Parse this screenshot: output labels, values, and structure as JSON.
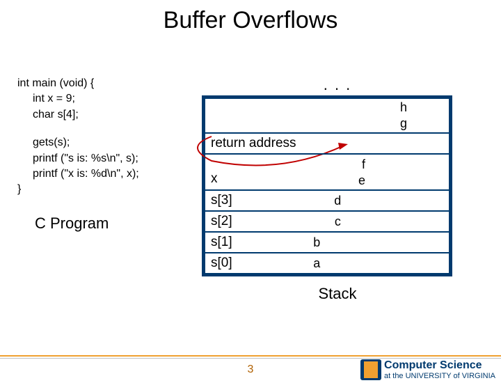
{
  "title": "Buffer Overflows",
  "code": {
    "line1": "int main (void) {",
    "line2": "int x = 9;",
    "line3": "char s[4];",
    "line4": "gets(s);",
    "line5": "printf (\"s is: %s\\n\", s);",
    "line6": "printf (\"x is: %d\\n\", x);",
    "line7": "}"
  },
  "program_label": "C Program",
  "stack": {
    "dots": ". . .",
    "rows": [
      {
        "label": "",
        "value_top": "h",
        "value_bottom": "g",
        "prefix": "return address"
      },
      {
        "label": "x",
        "value_top": "f",
        "value_bottom": "e"
      },
      {
        "label": "s[3]",
        "value": "d"
      },
      {
        "label": "s[2]",
        "value": "c"
      },
      {
        "label": "s[1]",
        "value": "b"
      },
      {
        "label": "s[0]",
        "value": "a"
      }
    ],
    "label": "Stack"
  },
  "page_number": "3",
  "logo": {
    "top": "Computer Science",
    "bottom": "at the UNIVERSITY of VIRGINIA"
  }
}
